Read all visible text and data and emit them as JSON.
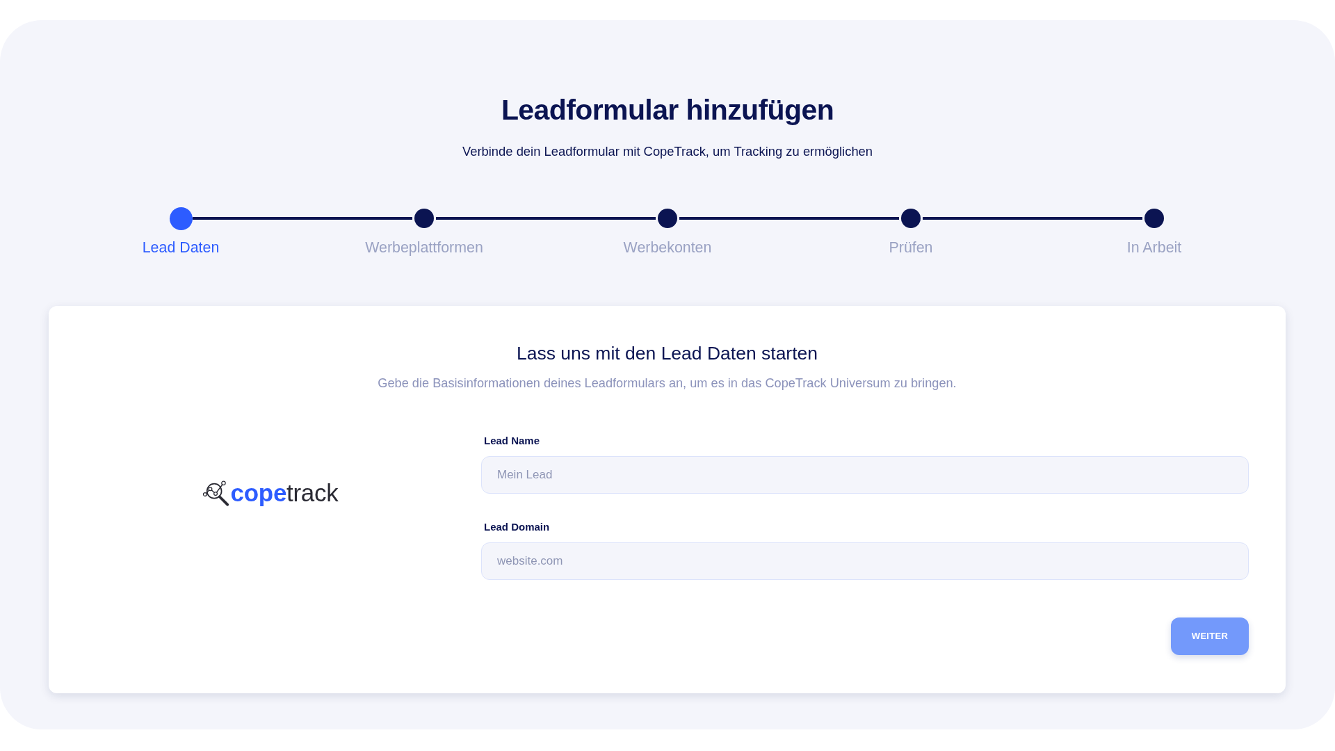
{
  "header": {
    "title": "Leadformular hinzufügen",
    "subtitle": "Verbinde dein Leadformular mit CopeTrack, um Tracking zu ermöglichen"
  },
  "stepper": {
    "steps": [
      {
        "label": "Lead Daten",
        "selected": true
      },
      {
        "label": "Werbeplattformen",
        "selected": false
      },
      {
        "label": "Werbekonten",
        "selected": false
      },
      {
        "label": "Prüfen",
        "selected": false
      },
      {
        "label": "In Arbeit",
        "selected": false
      }
    ]
  },
  "card": {
    "title": "Lass uns mit den Lead Daten starten",
    "subtitle": "Gebe die Basisinformationen deines Leadformulars an, um es in das CopeTrack Universum zu bringen.",
    "logo": {
      "bold_part": "cope",
      "light_part": "track"
    },
    "fields": [
      {
        "label": "Lead Name",
        "placeholder": "Mein Lead"
      },
      {
        "label": "Lead Domain",
        "placeholder": "website.com"
      }
    ],
    "button": {
      "label": "WEITER",
      "disabled": true
    }
  }
}
